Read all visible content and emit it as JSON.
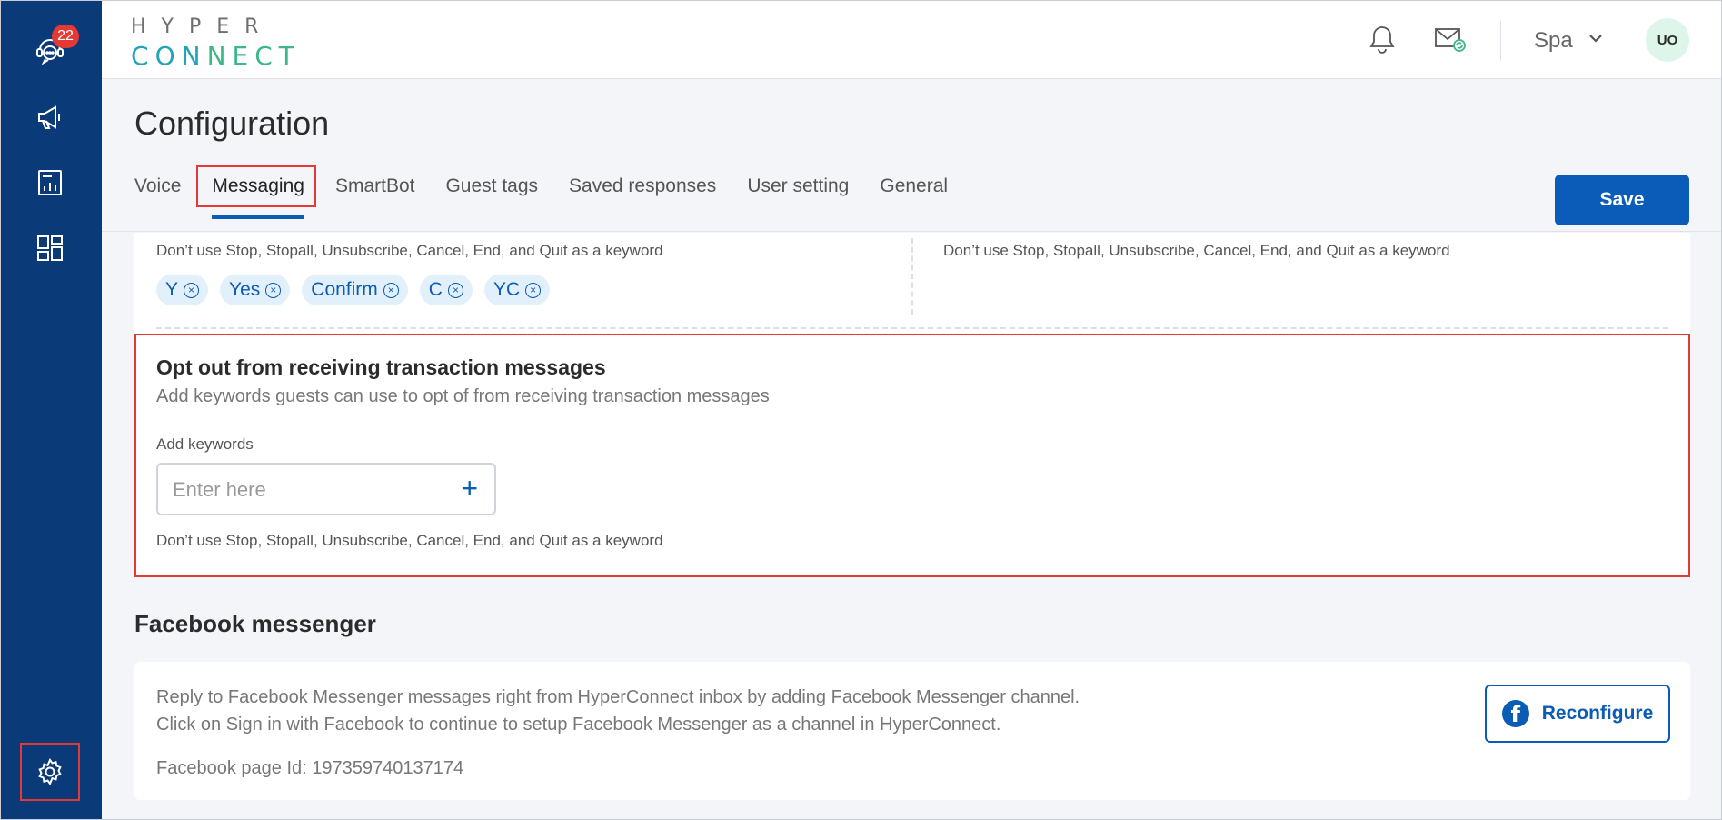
{
  "sidebar": {
    "badge_count": "22",
    "items": [
      {
        "icon": "support-chat-icon"
      },
      {
        "icon": "megaphone-icon"
      },
      {
        "icon": "report-icon"
      },
      {
        "icon": "dashboard-icon"
      }
    ],
    "settings_icon": "gear-icon"
  },
  "header": {
    "logo_top": "HYPER",
    "logo_bottom": "CONNECT",
    "org": "Spa",
    "avatar": "UO"
  },
  "page": {
    "title": "Configuration",
    "save_label": "Save",
    "tabs": [
      {
        "label": "Voice"
      },
      {
        "label": "Messaging",
        "active": true
      },
      {
        "label": "SmartBot"
      },
      {
        "label": "Guest tags"
      },
      {
        "label": "Saved responses"
      },
      {
        "label": "User setting"
      },
      {
        "label": "General"
      }
    ]
  },
  "keywords_top": {
    "note_left": "Don’t use Stop, Stopall, Unsubscribe, Cancel, End, and Quit as a keyword",
    "note_right": "Don’t use Stop, Stopall, Unsubscribe, Cancel, End, and Quit as a keyword",
    "chips": [
      "Y",
      "Yes",
      "Confirm",
      "C",
      "YC"
    ],
    "chip_remove_symbol": "×"
  },
  "optout": {
    "title": "Opt out from receiving transaction messages",
    "description": "Add keywords guests can use to opt of from receiving transaction messages",
    "label": "Add keywords",
    "placeholder": "Enter here",
    "add_symbol": "+",
    "note": "Don’t use Stop, Stopall, Unsubscribe, Cancel, End, and Quit as a keyword"
  },
  "facebook": {
    "heading": "Facebook messenger",
    "line1": "Reply to Facebook Messenger messages right from HyperConnect inbox by adding Facebook Messenger channel.",
    "line2": "Click on Sign in with Facebook to continue to setup Facebook Messenger as a channel in HyperConnect.",
    "page_id": "Facebook page Id: 197359740137174",
    "button_label": "Reconfigure",
    "button_logo": "f"
  },
  "colors": {
    "sidebar": "#0b3a78",
    "primary": "#0a5cb8",
    "highlight": "#e53935"
  }
}
